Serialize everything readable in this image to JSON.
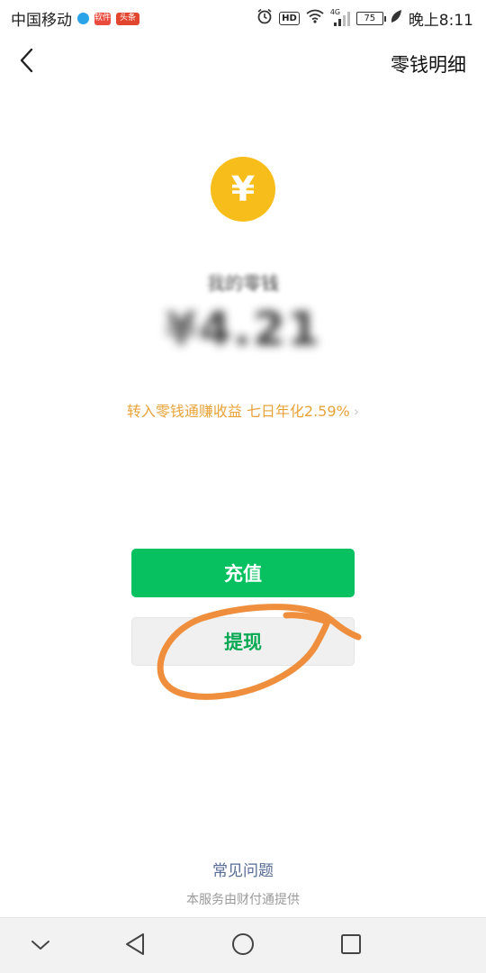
{
  "status_bar": {
    "carrier": "中国移动",
    "app_badge_b": "软件",
    "app_badge_c": "头条",
    "hd": "HD",
    "network": "4G",
    "battery": "75",
    "time": "晚上8:11"
  },
  "header": {
    "title": "零钱明细"
  },
  "coin": {
    "symbol": "¥"
  },
  "balance": {
    "label": "我的零钱",
    "amount": "¥4.21"
  },
  "promo": {
    "text": "转入零钱通赚收益 七日年化2.59%",
    "chevron": "›"
  },
  "buttons": {
    "recharge": "充值",
    "withdraw": "提现"
  },
  "footer": {
    "faq": "常见问题",
    "provider": "本服务由财付通提供"
  },
  "colors": {
    "accent_green": "#07c160",
    "coin_yellow": "#f7bd1a",
    "promo_orange": "#e8a33b",
    "annotation_orange": "#ef8f3d",
    "link_blue": "#576b95"
  },
  "icons": {
    "back": "chevron-left-icon",
    "nav_hide": "chevron-down-icon",
    "nav_back": "triangle-back-icon",
    "nav_home": "circle-home-icon",
    "nav_recents": "square-recents-icon"
  }
}
